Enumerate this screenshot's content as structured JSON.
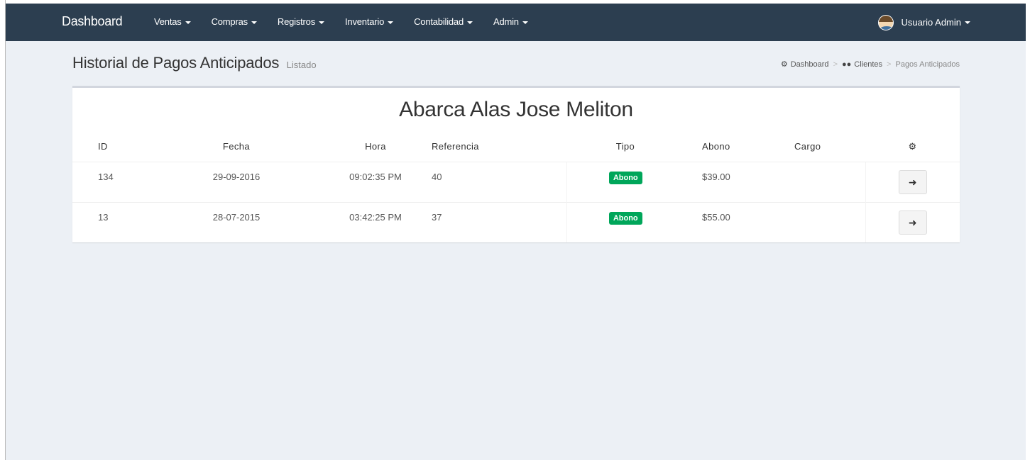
{
  "navbar": {
    "brand": "Dashboard",
    "menus": [
      {
        "label": "Ventas"
      },
      {
        "label": "Compras"
      },
      {
        "label": "Registros"
      },
      {
        "label": "Inventario"
      },
      {
        "label": "Contabilidad"
      },
      {
        "label": "Admin"
      }
    ],
    "user_label": "Usuario Admin",
    "bg_color": "#2c3e50"
  },
  "header": {
    "title": "Historial de Pagos Anticipados",
    "subtitle": "Listado"
  },
  "breadcrumb": {
    "items": [
      {
        "label": "Dashboard",
        "icon": "dashboard-icon"
      },
      {
        "label": "Clientes",
        "icon": "users-icon"
      },
      {
        "label": "Pagos Anticipados"
      }
    ]
  },
  "box": {
    "client_name": "Abarca Alas Jose Meliton",
    "columns": [
      "ID",
      "Fecha",
      "Hora",
      "Referencia",
      "Tipo",
      "Abono",
      "Cargo"
    ],
    "actions_header_icon": "gear-icon",
    "rows": [
      {
        "id": "134",
        "fecha": "29-09-2016",
        "hora": "09:02:35 PM",
        "referencia": "40",
        "tipo": "Abono",
        "abono": "$39.00",
        "cargo": ""
      },
      {
        "id": "13",
        "fecha": "28-07-2015",
        "hora": "03:42:25 PM",
        "referencia": "37",
        "tipo": "Abono",
        "abono": "$55.00",
        "cargo": ""
      }
    ],
    "row_action_icon": "arrow-right-icon",
    "badge_color": "#00a65a"
  }
}
